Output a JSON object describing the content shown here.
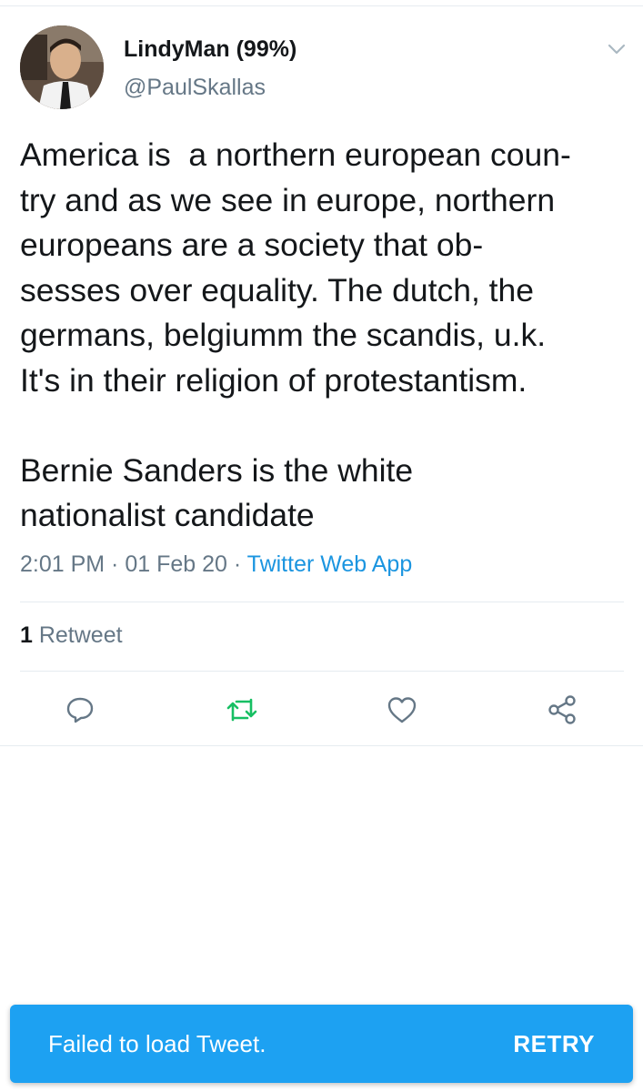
{
  "tweet": {
    "author": {
      "display_name": "LindyMan (99%)",
      "handle": "@PaulSkallas"
    },
    "body_lines": [
      "America is  a northern european coun-",
      "try and as we see in europe, northern",
      "europeans are a society that ob-",
      "sesses over equality. The dutch, the",
      "germans, belgiumm the scandis, u.k.",
      "It's in their religion of protestantism.",
      "",
      "Bernie Sanders is the white",
      "nationalist candidate"
    ],
    "timestamp": "2:01 PM · 01 Feb 20 · ",
    "source": "Twitter Web App",
    "retweet_count": "1",
    "retweet_label": " Retweet"
  },
  "icons": {
    "menu": "chevron-down-icon",
    "reply": "reply-icon",
    "retweet": "retweet-icon",
    "like": "heart-icon",
    "share": "share-icon"
  },
  "colors": {
    "accent": "#1da1f2",
    "retweet_active": "#17bf63",
    "secondary_text": "#657786",
    "link": "#1b95e0"
  },
  "snackbar": {
    "message": "Failed to load Tweet.",
    "action": "RETRY"
  }
}
